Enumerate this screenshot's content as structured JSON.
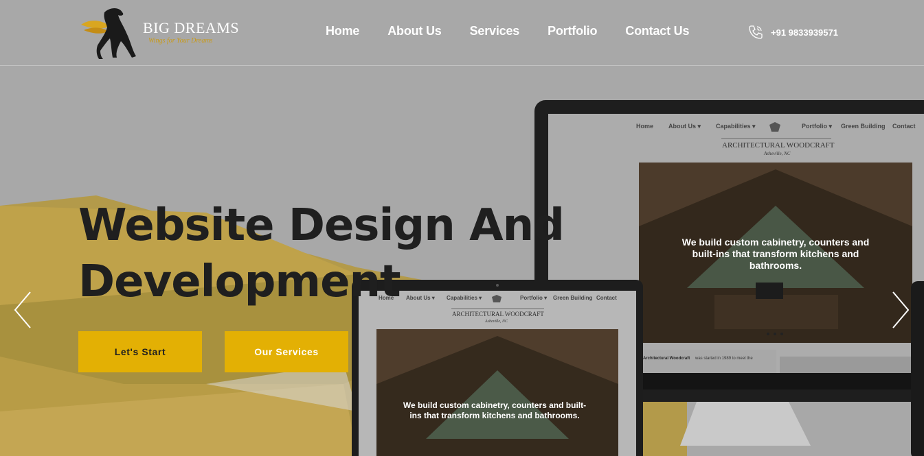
{
  "brand": {
    "name": "BIG DREAMS",
    "tagline": "Wings for Your Dreams"
  },
  "nav": {
    "items": [
      "Home",
      "About Us",
      "Services",
      "Portfolio",
      "Contact Us"
    ]
  },
  "contact": {
    "phone": "+91 9833939571",
    "icon": "phone-icon"
  },
  "hero": {
    "title_line1": "Website Design And",
    "title_line2": "Development",
    "buttons": {
      "start": "Let's Start",
      "services": "Our Services"
    },
    "prev_icon": "chevron-left-icon",
    "next_icon": "chevron-right-icon"
  },
  "mockup": {
    "nav": [
      "Home",
      "About Us ▾",
      "Capabilities ▾",
      "Portfolio ▾",
      "Green Building",
      "Contact"
    ],
    "brand": "ARCHITECTURAL WOODCRAFT",
    "location": "Asheville, NC",
    "monitor_caption_line1": "We build custom cabinetry, counters and",
    "monitor_caption_line2": "built-ins that transform kitchens and",
    "monitor_caption_line3": "bathrooms.",
    "laptop_caption_line1": "We build custom cabinetry, counters and built-",
    "laptop_caption_line2": "ins that transform kitchens and bathrooms.",
    "body_lead": "Architectural Woodcraft",
    "body_text": "was started in 1989 to meet the"
  },
  "colors": {
    "accent": "#e3b004",
    "background": "#a8a8a8",
    "title": "#1f1f1f"
  }
}
